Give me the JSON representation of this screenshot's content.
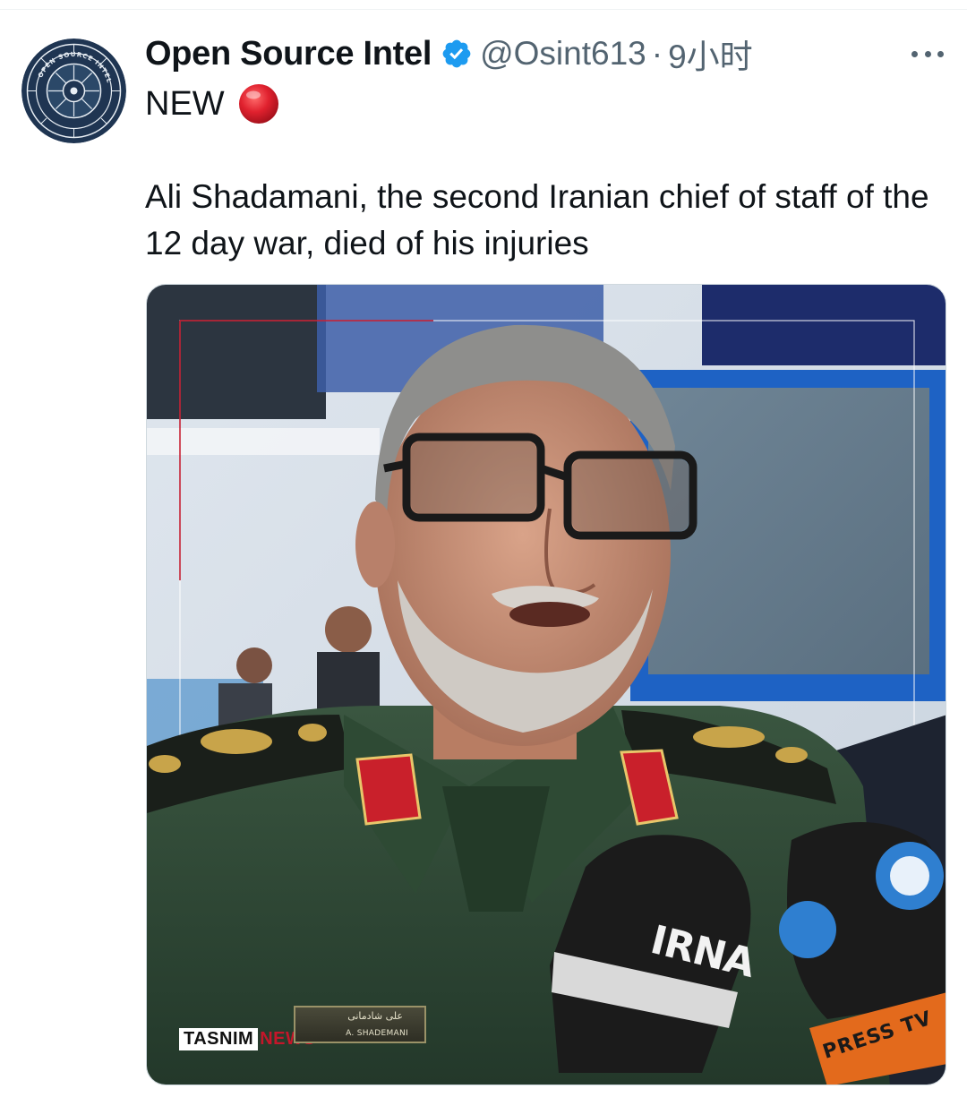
{
  "tweet": {
    "author": {
      "display_name": "Open Source Intel",
      "handle": "@Osint613",
      "separator": "·",
      "timestamp": "9小时",
      "verified": true,
      "avatar_icon": "osint-logo-icon",
      "avatar_ring_text": "OPEN SOURCE INTEL"
    },
    "more_icon": "more-dots-icon",
    "label": "NEW",
    "label_icon": "red-circle-icon",
    "text": "Ali Shadamani, the second Iranian chief of staff of the 12 day war, died of his injuries",
    "media": {
      "type": "photo",
      "watermark_brand": "TASNIM",
      "watermark_suffix": "NEWS",
      "nametag_line1": "علی شادمانی",
      "nametag_line2": "A. SHADEMANI",
      "mic_brand_1": "IRNA",
      "mic_brand_2": "PRESS TV"
    }
  },
  "colors": {
    "text_primary": "#0f1419",
    "text_secondary": "#536471",
    "verified_blue": "#1d9bf0",
    "red": "#e0212e",
    "uniform_green": "#2f4a32"
  }
}
